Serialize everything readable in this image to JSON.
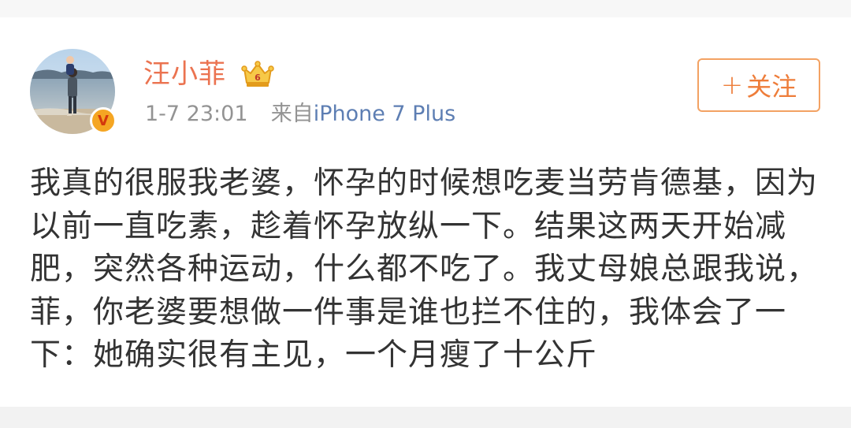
{
  "user": {
    "name": "汪小菲",
    "verified_badge": "V",
    "vip_icon": "crown-vip-icon"
  },
  "meta": {
    "time": "1-7 23:01",
    "source_prefix": "来自",
    "device": "iPhone 7 Plus"
  },
  "follow_button": {
    "plus": "+",
    "label": "关注"
  },
  "post": {
    "text": "我真的很服我老婆，怀孕的时候想吃麦当劳肯德基，因为以前一直吃素，趁着怀孕放纵一下。结果这两天开始减肥，突然各种运动，什么都不吃了。我丈母娘总跟我说，菲，你老婆要想做一件事是谁也拦不住的，我体会了一下：她确实很有主见，一个月瘦了十公斤"
  },
  "colors": {
    "username": "#eb7350",
    "follow_border": "#f3a263",
    "follow_text": "#ee7d3a",
    "meta_gray": "#939393",
    "device_blue": "#5d7eb3",
    "body_text": "#333333"
  }
}
